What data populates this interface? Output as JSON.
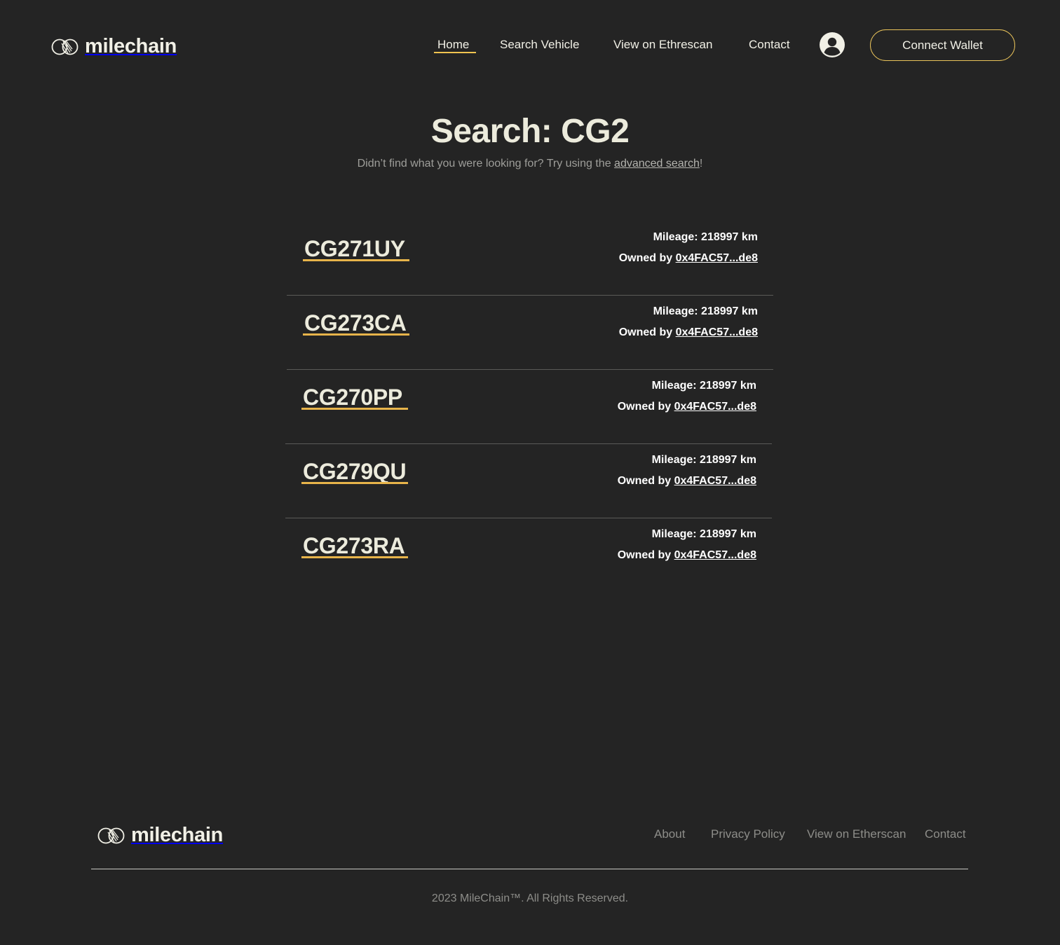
{
  "brand": {
    "name": "milechain",
    "accent_color": "#f0c450",
    "background_color": "#242424"
  },
  "header": {
    "nav": {
      "home": "Home",
      "search_vehicle": "Search Vehicle",
      "view_on_ethrescan": "View on Ethrescan",
      "contact": "Contact"
    },
    "account_icon": "user-circle-icon",
    "connect_wallet": "Connect Wallet"
  },
  "main": {
    "title": "Search: CG2",
    "subtitle_prefix": "Didn’t find what you were looking for? Try using the ",
    "subtitle_link": "advanced search",
    "subtitle_suffix": "!",
    "results": [
      {
        "plate": "CG271UY",
        "mileage": "Mileage: 218997 km",
        "owner_prefix": "Owned by ",
        "owner_address": "0x4FAC57...de8"
      },
      {
        "plate": "CG273CA",
        "mileage": "Mileage: 218997 km",
        "owner_prefix": "Owned by ",
        "owner_address": "0x4FAC57...de8"
      },
      {
        "plate": "CG270PP",
        "mileage": "Mileage: 218997 km",
        "owner_prefix": "Owned by ",
        "owner_address": "0x4FAC57...de8"
      },
      {
        "plate": "CG279QU",
        "mileage": "Mileage: 218997 km",
        "owner_prefix": "Owned by ",
        "owner_address": "0x4FAC57...de8"
      },
      {
        "plate": "CG273RA",
        "mileage": "Mileage: 218997 km",
        "owner_prefix": "Owned by ",
        "owner_address": "0x4FAC57...de8"
      }
    ]
  },
  "footer": {
    "brand_name": "milechain",
    "links": {
      "about": "About",
      "privacy_policy": "Privacy Policy",
      "view_on_etherscan": "View on Etherscan",
      "contact": "Contact"
    },
    "copyright": "2023 MileChain™. All Rights Reserved."
  }
}
